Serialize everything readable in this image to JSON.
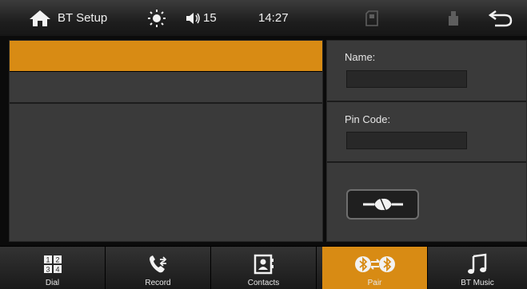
{
  "header": {
    "title": "BT Setup",
    "volume": "15",
    "time": "14:27",
    "icons": [
      "home-icon",
      "brightness-icon",
      "speaker-icon",
      "sd-card-icon",
      "usb-icon",
      "back-icon"
    ]
  },
  "devices": {
    "rows": [
      "",
      ""
    ]
  },
  "form": {
    "name_label": "Name:",
    "name_value": "",
    "pin_label": "Pin Code:",
    "pin_value": ""
  },
  "bottom_nav": {
    "items": [
      {
        "label": "Dial",
        "icon": "dialpad-icon"
      },
      {
        "label": "Record",
        "icon": "call-log-icon"
      },
      {
        "label": "Contacts",
        "icon": "contacts-icon"
      },
      {
        "label": "Pair",
        "icon": "bluetooth-pair-icon"
      },
      {
        "label": "BT Music",
        "icon": "music-note-icon"
      }
    ],
    "dial_keys": [
      "1",
      "2",
      "3",
      "4"
    ],
    "active": "Pair"
  },
  "colors": {
    "accent": "#d88b14",
    "panel": "#3a3a3a",
    "background": "#0b0b0b"
  }
}
